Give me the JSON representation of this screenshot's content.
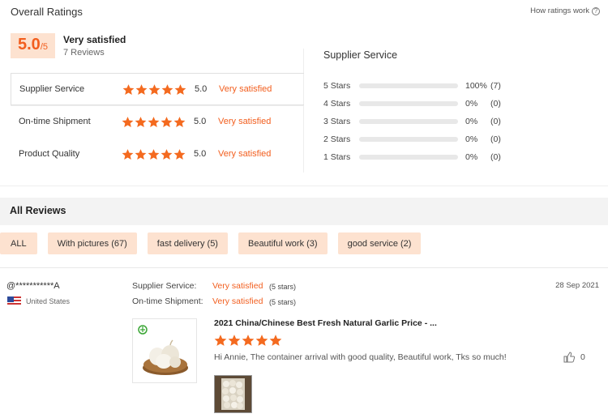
{
  "header": {
    "title": "Overall Ratings",
    "how_link": "How ratings work",
    "help_glyph": "?"
  },
  "overall": {
    "score": "5.0",
    "out_of": "/5",
    "label": "Very satisfied",
    "reviews": "7 Reviews"
  },
  "ratings": [
    {
      "label": "Supplier Service",
      "value": "5.0",
      "text": "Very satisfied",
      "stars": 5
    },
    {
      "label": "On-time Shipment",
      "value": "5.0",
      "text": "Very satisfied",
      "stars": 5
    },
    {
      "label": "Product Quality",
      "value": "5.0",
      "text": "Very satisfied",
      "stars": 5
    }
  ],
  "breakdown": {
    "title": "Supplier Service",
    "rows": [
      {
        "label": "5 Stars",
        "pct": "100%",
        "count": "(7)",
        "fraction": 1.0
      },
      {
        "label": "4 Stars",
        "pct": "0%",
        "count": "(0)",
        "fraction": 0
      },
      {
        "label": "3 Stars",
        "pct": "0%",
        "count": "(0)",
        "fraction": 0
      },
      {
        "label": "2 Stars",
        "pct": "0%",
        "count": "(0)",
        "fraction": 0
      },
      {
        "label": "1 Stars",
        "pct": "0%",
        "count": "(0)",
        "fraction": 0
      }
    ]
  },
  "all_reviews": {
    "title": "All Reviews",
    "filters": [
      "ALL",
      "With pictures (67)",
      "fast delivery (5)",
      "Beautiful work (3)",
      "good service (2)"
    ]
  },
  "review": {
    "user": "@***********A",
    "country": "United States",
    "date": "28 Sep 2021",
    "supplier_service_label": "Supplier Service:",
    "supplier_service_value": "Very satisfied",
    "supplier_service_stars": "(5 stars)",
    "shipment_label": "On-time Shipment:",
    "shipment_value": "Very satisfied",
    "shipment_stars": "(5 stars)",
    "product_title": "2021 China/Chinese Best Fresh Natural Garlic Price - ...",
    "product_stars": 5,
    "comment": "Hi Annie, The container arrival with good quality, Beautiful work, Tks so much!",
    "likes": "0"
  },
  "colors": {
    "accent": "#f25e1e",
    "chip_bg": "#fde2d0"
  }
}
